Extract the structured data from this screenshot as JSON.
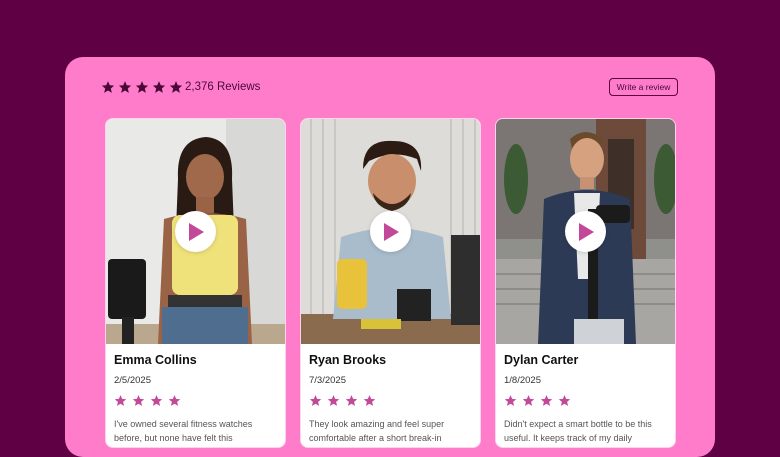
{
  "header": {
    "rating_stars": 5,
    "review_count": "2,376 Reviews",
    "write_button": "Write a review"
  },
  "colors": {
    "background": "#5e0043",
    "panel": "#ff7ccb",
    "accent": "#c2489a",
    "dark_star": "#4a0838"
  },
  "icons": {
    "header_star": "star-icon",
    "play": "play-icon",
    "card_star": "star-icon"
  },
  "cards": [
    {
      "name": "Emma Collins",
      "date": "2/5/2025",
      "stars": 4,
      "review": "I've owned several fitness watches before, but none have felt this"
    },
    {
      "name": "Ryan Brooks",
      "date": "7/3/2025",
      "stars": 4,
      "review": "They look amazing and feel super comfortable after a short break-in"
    },
    {
      "name": "Dylan Carter",
      "date": "1/8/2025",
      "stars": 4,
      "review": "Didn't expect a smart bottle to be this useful. It keeps track of my daily"
    }
  ]
}
